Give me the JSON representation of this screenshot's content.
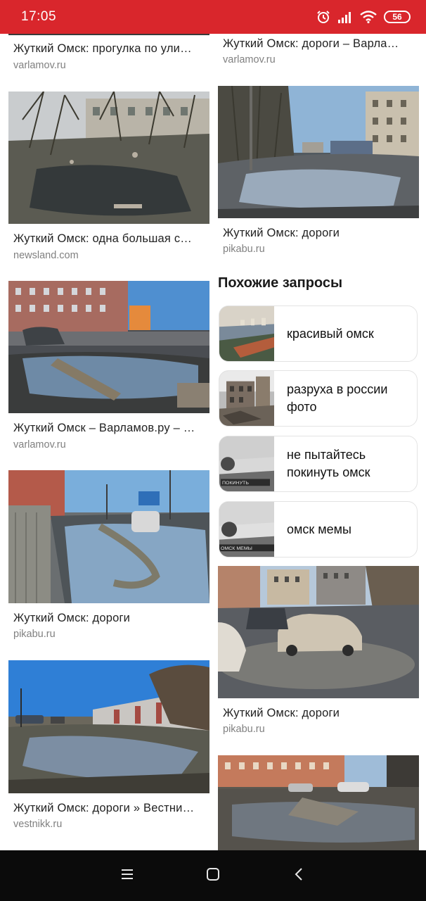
{
  "status_bar": {
    "time": "17:05",
    "battery": "56",
    "icons": [
      "alarm-icon",
      "signal-icon",
      "wifi-icon",
      "battery-icon"
    ]
  },
  "left_column": [
    {
      "title": "Жуткий Омск: прогулка по ули…",
      "source": "varlamov.ru"
    },
    {
      "title": "Жуткий Омск: одна большая с…",
      "source": "newsland.com"
    },
    {
      "title": "Жуткий Омск – Варламов.ру – …",
      "source": "varlamov.ru"
    },
    {
      "title": "Жуткий Омск: дороги",
      "source": "pikabu.ru"
    },
    {
      "title": "Жуткий Омск: дороги » Вестни…",
      "source": "vestnikk.ru"
    }
  ],
  "right_column": [
    {
      "title": "Жуткий Омск: дороги – Варла…",
      "source": "varlamov.ru"
    },
    {
      "title": "Жуткий Омск: дороги",
      "source": "pikabu.ru"
    },
    {
      "title": "Жуткий Омск: дороги",
      "source": "pikabu.ru"
    },
    {
      "title": "",
      "source": ""
    }
  ],
  "related": {
    "heading": "Похожие запросы",
    "items": [
      {
        "label": "красивый омск"
      },
      {
        "label": "разруха в россии фото"
      },
      {
        "label": "не пытайтесь покинуть омск"
      },
      {
        "label": "омск мемы"
      }
    ]
  },
  "nav_bar": {
    "buttons": [
      "menu-icon",
      "home-icon",
      "back-icon"
    ]
  },
  "colors": {
    "status_bar": "#d9262c",
    "nav_bar": "#0b0b0b",
    "title_text": "#222222",
    "source_text": "#808080"
  }
}
